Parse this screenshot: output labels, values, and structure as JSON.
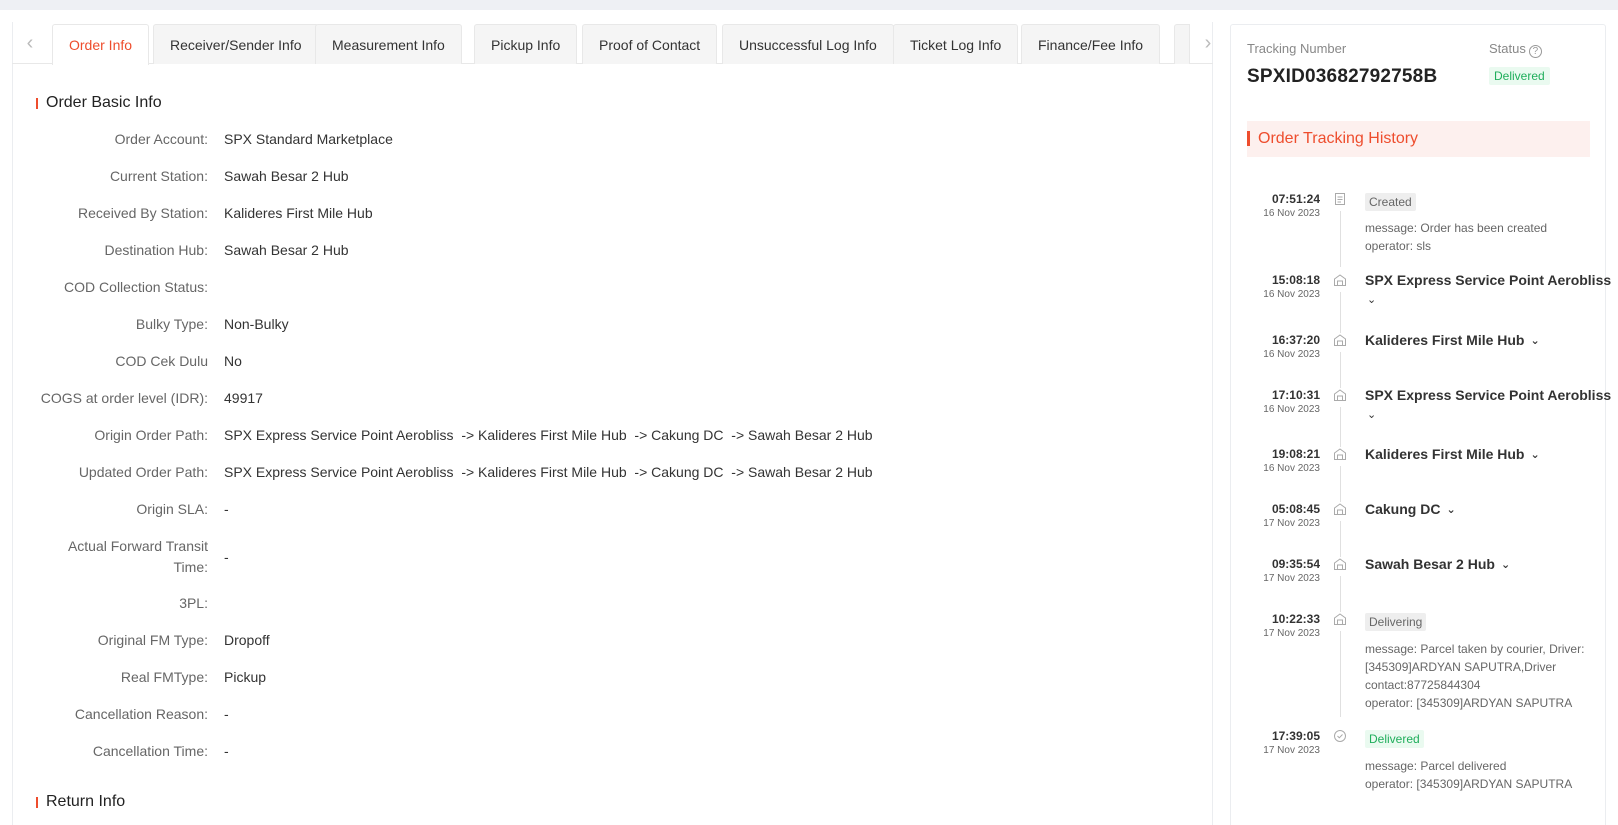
{
  "tabs": [
    {
      "label": "Order Info",
      "active": true
    },
    {
      "label": "Receiver/Sender Info"
    },
    {
      "label": "Measurement Info"
    },
    {
      "label": "Pickup Info"
    },
    {
      "label": "Proof of Contact"
    },
    {
      "label": "Unsuccessful Log Info"
    },
    {
      "label": "Ticket Log Info"
    },
    {
      "label": "Finance/Fee Info"
    }
  ],
  "order_basic": {
    "title": "Order Basic Info",
    "fields": [
      {
        "label": "Order Account:",
        "value": "SPX Standard Marketplace"
      },
      {
        "label": "Current Station:",
        "value": "Sawah Besar 2 Hub"
      },
      {
        "label": "Received By Station:",
        "value": "Kalideres First Mile Hub"
      },
      {
        "label": "Destination Hub:",
        "value": "Sawah Besar 2 Hub"
      },
      {
        "label": "COD Collection Status:",
        "value": ""
      },
      {
        "label": "Bulky Type:",
        "value": "Non-Bulky"
      },
      {
        "label": "COD Cek Dulu",
        "value": "No"
      },
      {
        "label": "COGS at order level (IDR):",
        "value": "49917"
      },
      {
        "label": "Origin Order Path:",
        "value": "SPX Express Service Point Aerobliss  -> Kalideres First Mile Hub  -> Cakung DC  -> Sawah Besar 2 Hub"
      },
      {
        "label": "Updated Order Path:",
        "value": "SPX Express Service Point Aerobliss  -> Kalideres First Mile Hub  -> Cakung DC  -> Sawah Besar 2 Hub"
      },
      {
        "label": "Origin SLA:",
        "value": "-"
      },
      {
        "label_line1": "Actual Forward Transit",
        "label_line2": "Time:",
        "value": "-"
      },
      {
        "label": "3PL:",
        "value": ""
      },
      {
        "label": "Original FM Type:",
        "value": "Dropoff"
      },
      {
        "label": "Real FMType:",
        "value": "Pickup"
      },
      {
        "label": "Cancellation Reason:",
        "value": "-"
      },
      {
        "label": "Cancellation Time:",
        "value": "-"
      }
    ]
  },
  "return_info": {
    "title": "Return Info"
  },
  "tracking": {
    "number_label": "Tracking Number",
    "number": "SPXID03682792758B",
    "status_label": "Status",
    "status": "Delivered",
    "history_title": "Order Tracking History",
    "events": [
      {
        "time": "07:51:24",
        "date": "16 Nov 2023",
        "badge": "Created",
        "msg1": "message: Order has been created",
        "msg2": "operator: sls"
      },
      {
        "time": "15:08:18",
        "date": "16 Nov 2023",
        "title": "SPX Express Service Point Aerobliss"
      },
      {
        "time": "16:37:20",
        "date": "16 Nov 2023",
        "title": "Kalideres First Mile Hub"
      },
      {
        "time": "17:10:31",
        "date": "16 Nov 2023",
        "title": "SPX Express Service Point Aerobliss"
      },
      {
        "time": "19:08:21",
        "date": "16 Nov 2023",
        "title": "Kalideres First Mile Hub"
      },
      {
        "time": "05:08:45",
        "date": "17 Nov 2023",
        "title": "Cakung DC"
      },
      {
        "time": "09:35:54",
        "date": "17 Nov 2023",
        "title": "Sawah Besar 2 Hub"
      },
      {
        "time": "10:22:33",
        "date": "17 Nov 2023",
        "badge": "Delivering",
        "msg1": "message: Parcel taken by courier, Driver:",
        "msg2": "[345309]ARDYAN SAPUTRA,Driver",
        "msg3": "contact:87725844304",
        "msg4": "operator: [345309]ARDYAN SAPUTRA"
      },
      {
        "time": "17:39:05",
        "date": "17 Nov 2023",
        "badge": "Delivered",
        "msg1": "message: Parcel delivered",
        "msg2": "operator: [345309]ARDYAN SAPUTRA"
      }
    ]
  },
  "colors": {
    "accent": "#ee4d2d",
    "success": "#1fae5b"
  }
}
